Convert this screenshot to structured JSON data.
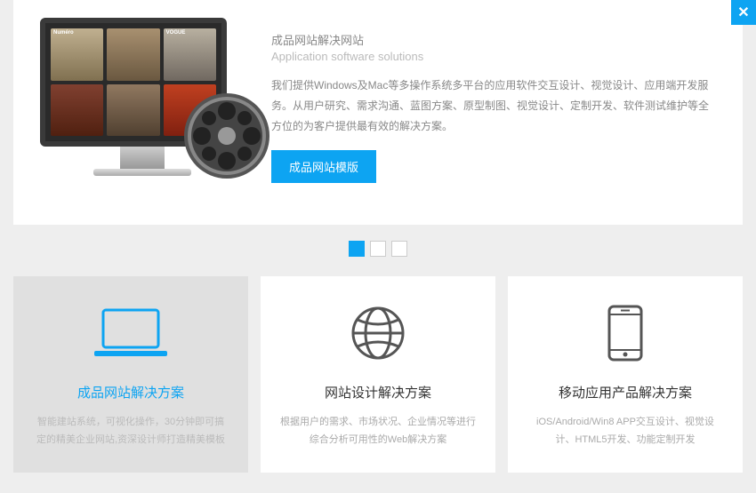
{
  "hero": {
    "title_cn": "成品网站解决网站",
    "title_en": "Application software solutions",
    "description": "我们提供Windows及Mac等多操作系统多平台的应用软件交互设计、视觉设计、应用端开发服务。从用户研究、需求沟通、蓝图方案、原型制图、视觉设计、定制开发、软件测试维护等全方位的为客户提供最有效的解决方案。",
    "button_label": "成品网站模版",
    "magazines": [
      "Numéro",
      "",
      "VOGUE",
      "",
      "",
      ""
    ]
  },
  "pager": {
    "count": 3,
    "active_index": 0
  },
  "cards": [
    {
      "title": "成品网站解决方案",
      "desc": "智能建站系统，可视化操作，30分钟即可搞定的精美企业网站,资深设计师打造精美模板",
      "icon": "laptop",
      "active": true
    },
    {
      "title": "网站设计解决方案",
      "desc": "根据用户的需求、市场状况、企业情况等进行综合分析可用性的Web解决方案",
      "icon": "globe",
      "active": false
    },
    {
      "title": "移动应用产品解决方案",
      "desc": "iOS/Android/Win8 APP交互设计、视觉设计、HTML5开发、功能定制开发",
      "icon": "mobile",
      "active": false
    }
  ],
  "colors": {
    "accent": "#0da4f2"
  }
}
